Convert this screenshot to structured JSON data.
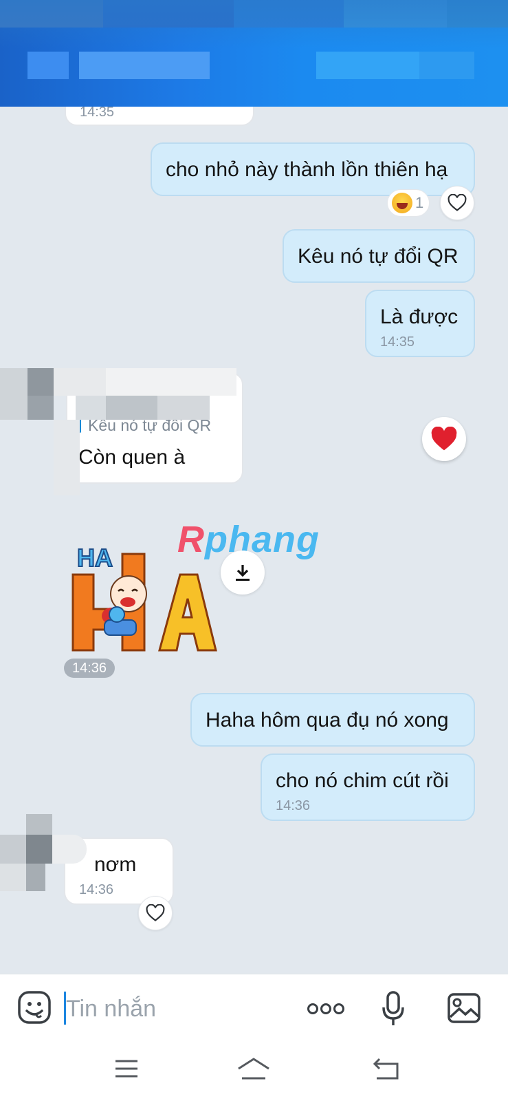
{
  "messages": [
    {
      "time": "14:35"
    },
    {
      "text": "cho nhỏ này thành lồn thiên hạ",
      "reaction_count": "1"
    },
    {
      "text": "Kêu nó tự đổi QR"
    },
    {
      "text": "Là được",
      "time": "14:35"
    },
    {
      "quote": "Kêu nó tự đổi QR",
      "text": "Còn quen à"
    },
    {
      "sticker_text": [
        "HA",
        "HA"
      ],
      "time": "14:36"
    },
    {
      "text": "Haha hôm qua đụ nó xong"
    },
    {
      "text": "cho nó chim cút rồi",
      "time": "14:36"
    },
    {
      "text": "nơm",
      "time": "14:36"
    }
  ],
  "watermark": {
    "part1": "R",
    "part2": "phang"
  },
  "composer": {
    "placeholder": "Tin nhắn"
  },
  "colors": {
    "header": "#1d7ae6",
    "outgoing_bubble": "#d3ecfb",
    "incoming_bubble": "#ffffff",
    "background": "#e2e8ee",
    "heart": "#e0202e"
  },
  "icons": [
    "sticker-icon",
    "more-icon",
    "microphone-icon",
    "image-icon",
    "menu-icon",
    "home-icon",
    "back-icon",
    "heart-icon",
    "download-icon"
  ]
}
